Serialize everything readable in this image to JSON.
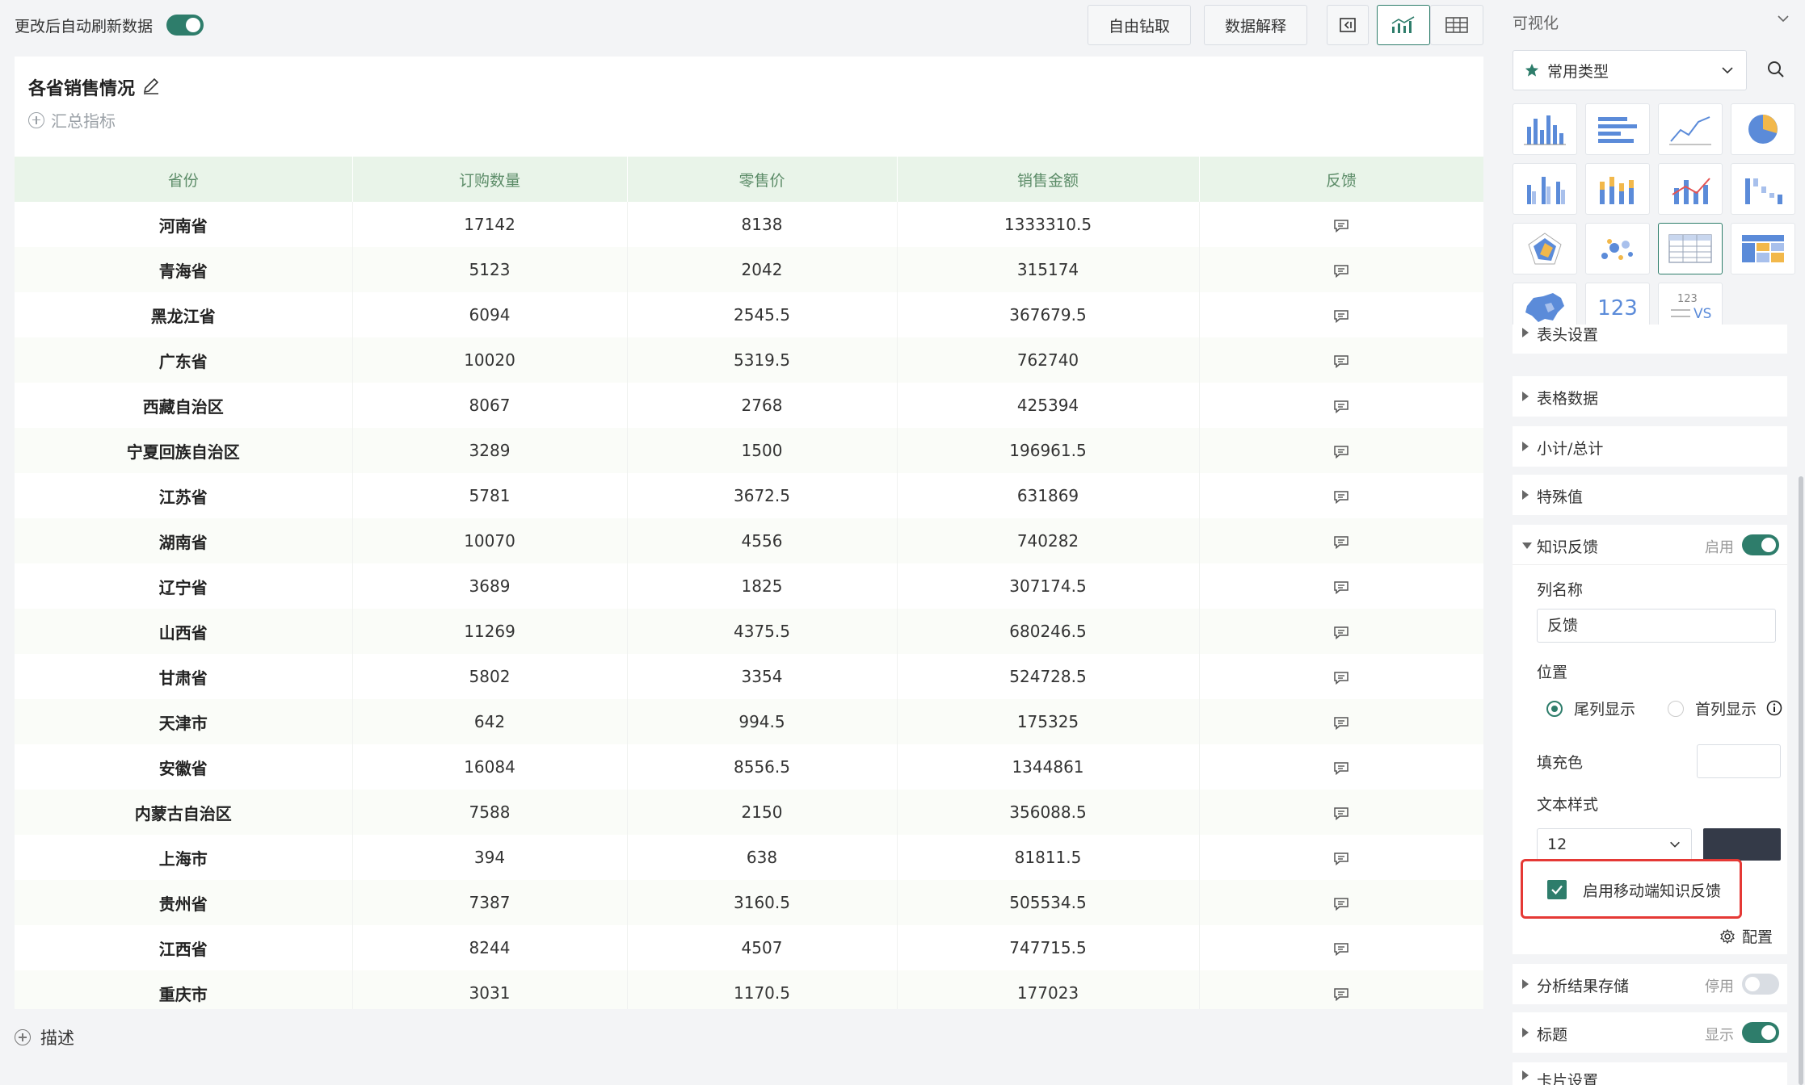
{
  "toolbar": {
    "auto_refresh_label": "更改后自动刷新数据",
    "drill_label": "自由钻取",
    "explain_label": "数据解释"
  },
  "card": {
    "title": "各省销售情况",
    "summary_label": "汇总指标"
  },
  "table": {
    "headers": [
      "省份",
      "订购数量",
      "零售价",
      "销售金额",
      "反馈"
    ],
    "rows": [
      [
        "河南省",
        "17142",
        "8138",
        "1333310.5"
      ],
      [
        "青海省",
        "5123",
        "2042",
        "315174"
      ],
      [
        "黑龙江省",
        "6094",
        "2545.5",
        "367679.5"
      ],
      [
        "广东省",
        "10020",
        "5319.5",
        "762740"
      ],
      [
        "西藏自治区",
        "8067",
        "2768",
        "425394"
      ],
      [
        "宁夏回族自治区",
        "3289",
        "1500",
        "196961.5"
      ],
      [
        "江苏省",
        "5781",
        "3672.5",
        "631869"
      ],
      [
        "湖南省",
        "10070",
        "4556",
        "740282"
      ],
      [
        "辽宁省",
        "3689",
        "1825",
        "307174.5"
      ],
      [
        "山西省",
        "11269",
        "4375.5",
        "680246.5"
      ],
      [
        "甘肃省",
        "5802",
        "3354",
        "524728.5"
      ],
      [
        "天津市",
        "642",
        "994.5",
        "175325"
      ],
      [
        "安徽省",
        "16084",
        "8556.5",
        "1344861"
      ],
      [
        "内蒙古自治区",
        "7588",
        "2150",
        "356088.5"
      ],
      [
        "上海市",
        "394",
        "638",
        "81811.5"
      ],
      [
        "贵州省",
        "7387",
        "3160.5",
        "505534.5"
      ],
      [
        "江西省",
        "8244",
        "4507",
        "747715.5"
      ],
      [
        "重庆市",
        "3031",
        "1170.5",
        "177023"
      ]
    ]
  },
  "describe_label": "描述",
  "panel": {
    "title": "可视化",
    "chart_type_label": "常用类型",
    "chart_tiles": [
      "123",
      "123",
      "VS"
    ],
    "sections": {
      "table_header": "表头设置",
      "table_data": "表格数据",
      "subtotal": "小计/总计",
      "special": "特殊值",
      "knowledge": "知识反馈",
      "knowledge_state": "启用",
      "analysis": "分析结果存储",
      "analysis_state": "停用",
      "title": "标题",
      "title_state": "显示",
      "card": "卡片设置"
    },
    "knowledge": {
      "column_name_label": "列名称",
      "column_name_value": "反馈",
      "position_label": "位置",
      "position_tail": "尾列显示",
      "position_head": "首列显示",
      "fill_label": "填充色",
      "text_style_label": "文本样式",
      "font_size": "12",
      "text_color": "#343a48",
      "mobile_label": "启用移动端知识反馈",
      "config_label": "配置"
    }
  },
  "colors": {
    "accent": "#2e7d6b",
    "highlight": "#e53935",
    "header_bg": "#e9f4e9"
  }
}
